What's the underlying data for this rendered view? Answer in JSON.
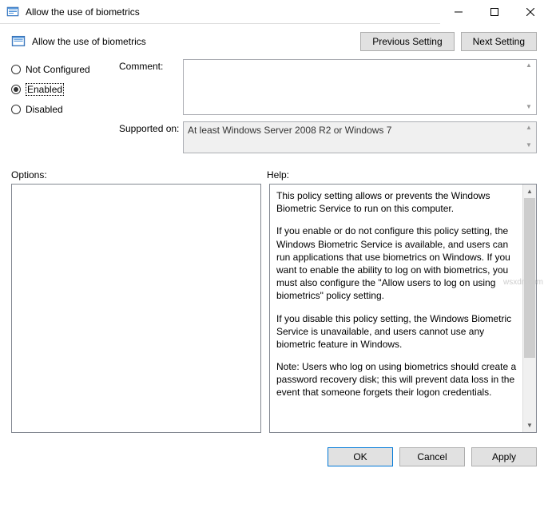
{
  "window": {
    "title": "Allow the use of biometrics"
  },
  "header": {
    "title": "Allow the use of biometrics",
    "prev_label": "Previous Setting",
    "next_label": "Next Setting"
  },
  "state": {
    "not_configured_label": "Not Configured",
    "enabled_label": "Enabled",
    "disabled_label": "Disabled",
    "selected": "enabled"
  },
  "fields": {
    "comment_label": "Comment:",
    "comment_value": "",
    "supported_label": "Supported on:",
    "supported_value": "At least Windows Server 2008 R2 or Windows 7"
  },
  "panels": {
    "options_label": "Options:",
    "help_label": "Help:"
  },
  "help": {
    "p1": "This policy setting allows or prevents the Windows Biometric Service to run on this computer.",
    "p2": "If you enable or do not configure this policy setting, the Windows Biometric Service is available, and users can run applications that use biometrics on Windows. If you want to enable the ability to log on with biometrics, you must also configure the \"Allow users to log on using biometrics\" policy setting.",
    "p3": "If you disable this policy setting, the Windows Biometric Service is unavailable, and users cannot use any biometric feature in Windows.",
    "p4": "Note: Users who log on using biometrics should create a password recovery disk; this will prevent data loss in the event that someone forgets their logon credentials."
  },
  "footer": {
    "ok_label": "OK",
    "cancel_label": "Cancel",
    "apply_label": "Apply"
  },
  "watermark": "wsxdn.com"
}
